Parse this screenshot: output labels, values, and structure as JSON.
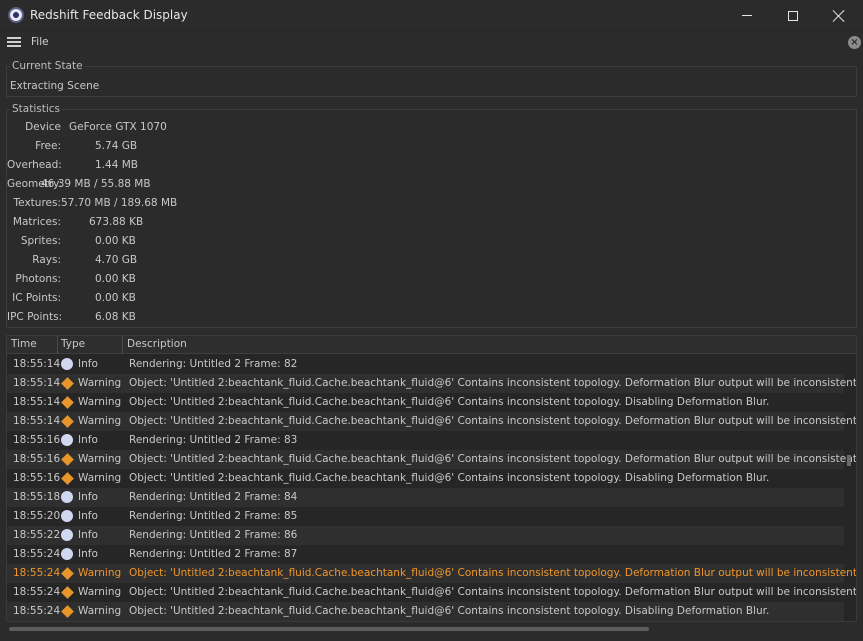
{
  "window": {
    "title": "Redshift Feedback Display"
  },
  "menu": {
    "file_label": "File"
  },
  "current_state": {
    "legend": "Current State",
    "value": "Extracting Scene"
  },
  "statistics": {
    "legend": "Statistics",
    "rows": [
      {
        "label": "Device",
        "value": "GeForce GTX 1070"
      },
      {
        "label": "Free:",
        "value": "5.74 GB"
      },
      {
        "label": "Overhead:",
        "value": "1.44 MB"
      },
      {
        "label": "Geometry:",
        "value": "46.39 MB / 55.88 MB"
      },
      {
        "label": "Textures:",
        "value": "57.70 MB / 189.68 MB"
      },
      {
        "label": "Matrices:",
        "value": "673.88 KB"
      },
      {
        "label": "Sprites:",
        "value": "0.00 KB"
      },
      {
        "label": "Rays:",
        "value": "4.70 GB"
      },
      {
        "label": "Photons:",
        "value": "0.00 KB"
      },
      {
        "label": "IC Points:",
        "value": "0.00 KB"
      },
      {
        "label": "IPC Points:",
        "value": "6.08 KB"
      }
    ]
  },
  "log": {
    "columns": {
      "time": "Time",
      "type": "Type",
      "description": "Description"
    },
    "highlight_color": "#f0952a",
    "rows": [
      {
        "time": "18:55:14",
        "type": "Info",
        "icon": "info-icon",
        "description": "Rendering: Untitled 2 Frame: 82"
      },
      {
        "time": "18:55:14",
        "type": "Warning",
        "icon": "warning-icon",
        "description": "Object: 'Untitled 2:beachtank_fluid.Cache.beachtank_fluid@6' Contains inconsistent topology. Deformation Blur output will be inconsistent."
      },
      {
        "time": "18:55:14",
        "type": "Warning",
        "icon": "warning-icon",
        "description": "Object: 'Untitled 2:beachtank_fluid.Cache.beachtank_fluid@6' Contains inconsistent topology. Disabling Deformation Blur."
      },
      {
        "time": "18:55:14",
        "type": "Warning",
        "icon": "warning-icon",
        "description": "Object: 'Untitled 2:beachtank_fluid.Cache.beachtank_fluid@6' Contains inconsistent topology. Deformation Blur output will be inconsistent."
      },
      {
        "time": "18:55:16",
        "type": "Info",
        "icon": "info-icon",
        "description": "Rendering: Untitled 2 Frame: 83"
      },
      {
        "time": "18:55:16",
        "type": "Warning",
        "icon": "warning-icon",
        "description": "Object: 'Untitled 2:beachtank_fluid.Cache.beachtank_fluid@6' Contains inconsistent topology. Deformation Blur output will be inconsistent."
      },
      {
        "time": "18:55:16",
        "type": "Warning",
        "icon": "warning-icon",
        "description": "Object: 'Untitled 2:beachtank_fluid.Cache.beachtank_fluid@6' Contains inconsistent topology. Disabling Deformation Blur."
      },
      {
        "time": "18:55:18",
        "type": "Info",
        "icon": "info-icon",
        "description": "Rendering: Untitled 2 Frame: 84"
      },
      {
        "time": "18:55:20",
        "type": "Info",
        "icon": "info-icon",
        "description": "Rendering: Untitled 2 Frame: 85"
      },
      {
        "time": "18:55:22",
        "type": "Info",
        "icon": "info-icon",
        "description": "Rendering: Untitled 2 Frame: 86"
      },
      {
        "time": "18:55:24",
        "type": "Info",
        "icon": "info-icon",
        "description": "Rendering: Untitled 2 Frame: 87"
      },
      {
        "time": "18:55:24",
        "type": "Warning",
        "icon": "warning-icon",
        "highlighted": true,
        "description": "Object: 'Untitled 2:beachtank_fluid.Cache.beachtank_fluid@6' Contains inconsistent topology. Deformation Blur output will be inconsistent."
      },
      {
        "time": "18:55:24",
        "type": "Warning",
        "icon": "warning-icon",
        "description": "Object: 'Untitled 2:beachtank_fluid.Cache.beachtank_fluid@6' Contains inconsistent topology. Deformation Blur output will be inconsistent."
      },
      {
        "time": "18:55:24",
        "type": "Warning",
        "icon": "warning-icon",
        "description": "Object: 'Untitled 2:beachtank_fluid.Cache.beachtank_fluid@6' Contains inconsistent topology. Disabling Deformation Blur."
      }
    ]
  }
}
